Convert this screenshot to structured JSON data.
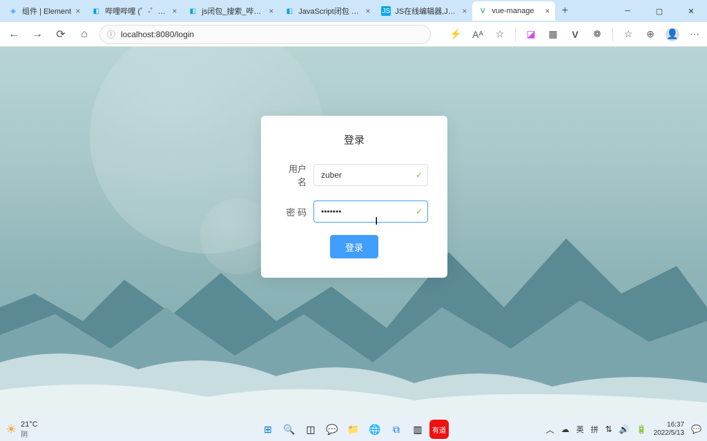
{
  "browser": {
    "tabs": [
      {
        "title": "组件 | Element",
        "favicon": "E"
      },
      {
        "title": "哔哩哔哩 (゜-゜)つ口",
        "favicon": "◧"
      },
      {
        "title": "js闭包_搜索_哔哩哔",
        "favicon": "◧"
      },
      {
        "title": "JavaScript闭包 - We",
        "favicon": "◧"
      },
      {
        "title": "JS在线编辑器,JS在线",
        "favicon": "JS"
      },
      {
        "title": "vue-manage",
        "favicon": "V",
        "active": true
      }
    ],
    "url": "localhost:8080/login"
  },
  "login": {
    "title": "登录",
    "username_label": "用户名",
    "username_value": "zuber",
    "password_label": "密 码",
    "password_value": "•••••••",
    "submit": "登录"
  },
  "taskbar": {
    "temp": "21°C",
    "weather": "阴",
    "ime": "英",
    "ime2": "拼",
    "time": "16:37",
    "date": "2022/5/13"
  }
}
